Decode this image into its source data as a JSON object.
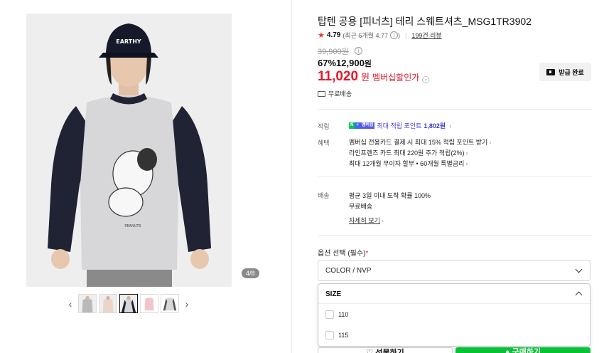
{
  "gallery": {
    "counter": "4/8",
    "thumbnails": [
      "thumb-1",
      "thumb-2",
      "thumb-3",
      "thumb-4",
      "thumb-5"
    ],
    "active_index": 2
  },
  "product": {
    "title": "탑텐 공용 [피너츠] 테리 스웨트셔츠_MSG1TR3902",
    "rating": "4.79",
    "rating_detail": "(최근 6개월 4.77",
    "rating_detail_end": ")",
    "review_link": "199건 리뷰",
    "original_price": "39,900원",
    "discount": "67%",
    "sale_price": "12,900",
    "sale_won": "원",
    "member_price": "11,020",
    "member_won": "원",
    "member_label": "멤버십할인가",
    "shipping_tag": "무료배송",
    "coupon_button": "받급 완료"
  },
  "benefits": {
    "points_label": "적립",
    "points_text": "최대 적립 포인트",
    "points_value": "1,802원",
    "benefits_label": "혜택",
    "benefit_items": [
      "멤버십 전용카드 결제 시 최대 15% 적립 포인트 받기",
      "라인프렌즈 카드 최대 220원 추가 적립(2%)",
      "최대 12개월 무이자 할부 • 60개월 특별금리"
    ]
  },
  "delivery": {
    "label": "배송",
    "line1": "평균 3일 이내 도착 확률 100%",
    "line2": "무료배송",
    "detail_link": "자세히 보기"
  },
  "options": {
    "title": "옵션 선택 (필수)",
    "required_mark": "*",
    "color_value": "COLOR / NVP",
    "size_header": "SIZE",
    "size_options": [
      "110",
      "115"
    ]
  },
  "actions": {
    "cart_label": "♡ 선물하기",
    "buy_label": "● 구매하기"
  },
  "colors": {
    "accent_red": "#e2192c",
    "buy_green": "#05c334",
    "points_blue": "#3a3acf"
  }
}
